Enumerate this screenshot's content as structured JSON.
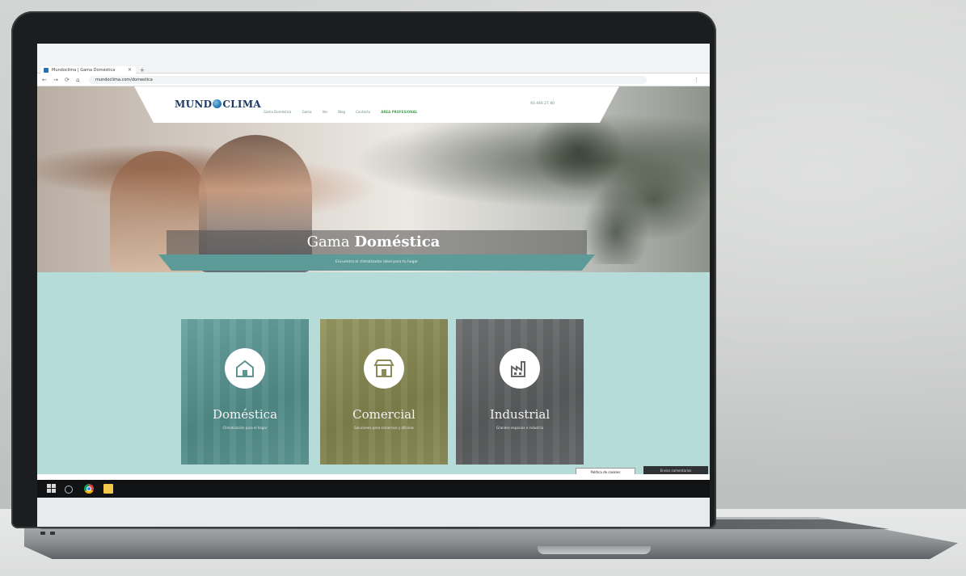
{
  "browser": {
    "tab_title": "Mundoclima | Gama Doméstica",
    "tab_close": "×",
    "new_tab": "+",
    "url": "mundoclima.com/domestica",
    "nav_back": "←",
    "nav_forward": "→",
    "nav_reload": "⟳",
    "nav_home": "⌂",
    "menu_dots": "⋮"
  },
  "site": {
    "logo_left": "MUND",
    "logo_right": "CLIMA",
    "menu": [
      "Gama Doméstica",
      "Gama",
      "Ver",
      "Blog",
      "Contacto",
      "ÁREA PROFESIONAL"
    ],
    "phone": "93 446 27 80",
    "hero_title_light": "Gama",
    "hero_title_bold": "Doméstica",
    "hero_subtitle": "Encuentra el climatizador ideal para tu hogar"
  },
  "cards": [
    {
      "label": "Doméstica",
      "desc": "Climatización para el hogar",
      "icon": "house-icon"
    },
    {
      "label": "Comercial",
      "desc": "Soluciones para comercios y oficinas",
      "icon": "storefront-icon"
    },
    {
      "label": "Industrial",
      "desc": "Grandes espacios e industria",
      "icon": "factory-icon"
    }
  ],
  "footer": {
    "cookie_button": "Política de cookies",
    "feedback_button": "Enviar comentarios"
  },
  "colors": {
    "page_bg": "#b5dcd9",
    "domestica": "#5c9491",
    "comercial": "#8a8b58",
    "industrial": "#646667",
    "logo": "#1b3a63"
  }
}
